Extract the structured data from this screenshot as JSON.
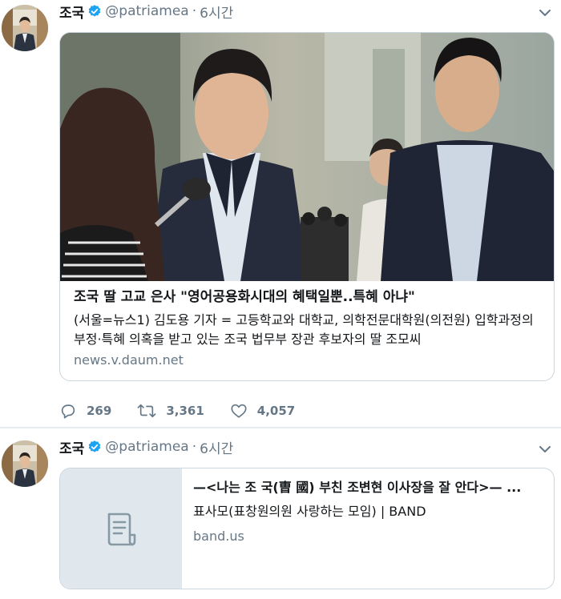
{
  "colors": {
    "text": "#14171a",
    "muted": "#657786",
    "border": "#ccd6dd",
    "verified": "#1da1f2",
    "divider": "#e6ecf0"
  },
  "tweets": [
    {
      "author": {
        "name": "조국",
        "handle": "@patriamea"
      },
      "separator": "·",
      "time": "6시간",
      "card": {
        "title": "조국 딸 고교 은사 \"영어공용화시대의 혜택일뿐..특혜 아냐\"",
        "description": "(서울=뉴스1) 김도용 기자 = 고등학교와 대학교, 의학전문대학원(의전원) 입학과정의 부정·특혜 의혹을 받고 있는 조국 법무부 장관 후보자의 딸 조모씨",
        "url": "news.v.daum.net"
      },
      "actions": {
        "reply_count": "269",
        "retweet_count": "3,361",
        "like_count": "4,057"
      }
    },
    {
      "author": {
        "name": "조국",
        "handle": "@patriamea"
      },
      "separator": "·",
      "time": "6시간",
      "card": {
        "title": "—<나는 조 국(曺 國) 부친 조변현 이사장을 잘 안다>— ...",
        "description": "표사모(표창원의원 사랑하는 모임) | BAND",
        "url": "band.us"
      }
    }
  ],
  "icons": [
    "verified-badge-icon",
    "chevron-down-icon",
    "reply-icon",
    "retweet-icon",
    "like-icon",
    "document-icon"
  ]
}
